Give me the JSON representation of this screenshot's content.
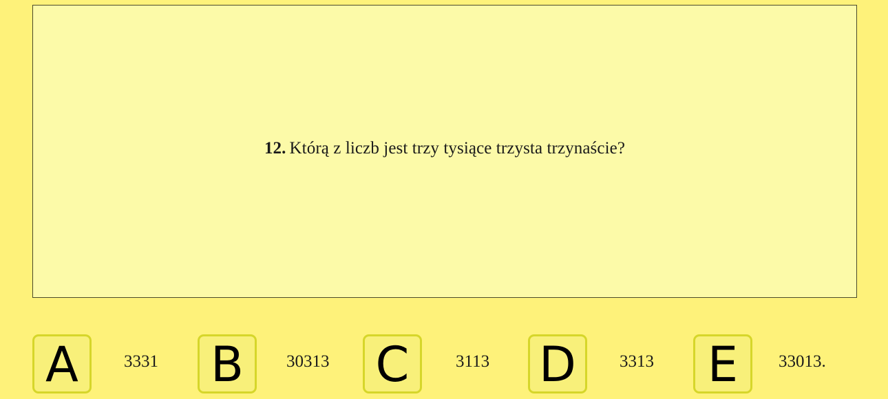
{
  "question": {
    "number": "12.",
    "text": "Którą z liczb jest trzy tysiące trzysta trzynaście?"
  },
  "answers": [
    {
      "letter": "A",
      "value": "3331"
    },
    {
      "letter": "B",
      "value": "30313"
    },
    {
      "letter": "C",
      "value": "3113"
    },
    {
      "letter": "D",
      "value": "3313"
    },
    {
      "letter": "E",
      "value": "33013."
    }
  ],
  "colors": {
    "background": "#fef27a",
    "panel": "#fcfaa8",
    "tile": "#f8f07a",
    "tile_border": "#d6d62a"
  }
}
